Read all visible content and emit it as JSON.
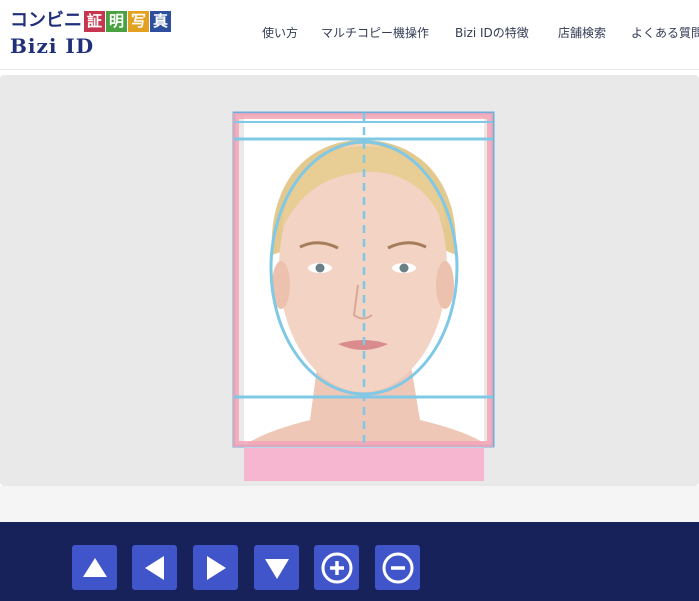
{
  "logo": {
    "kana": "コンビニ",
    "boxes": [
      {
        "char": "証",
        "color": "#c7364f"
      },
      {
        "char": "明",
        "color": "#4aa142"
      },
      {
        "char": "写",
        "color": "#e4a021"
      },
      {
        "char": "真",
        "color": "#2d4f9e"
      }
    ],
    "subtitle": "Bizi ID"
  },
  "nav": {
    "items": [
      "使い方",
      "マルチコピー機操作",
      "Bizi IDの特徴",
      "店舗検索",
      "よくある質問"
    ]
  },
  "photo": {
    "guide_color": "#7fc8e6",
    "frame_color": "#6eaedb",
    "pink_color": "#f5a4b6"
  },
  "toolbar": {
    "buttons": [
      {
        "name": "move-up-button",
        "icon": "arrow-up-icon"
      },
      {
        "name": "move-left-button",
        "icon": "arrow-left-icon"
      },
      {
        "name": "move-right-button",
        "icon": "arrow-right-icon"
      },
      {
        "name": "move-down-button",
        "icon": "arrow-down-icon"
      },
      {
        "name": "zoom-in-button",
        "icon": "zoom-in-icon"
      },
      {
        "name": "zoom-out-button",
        "icon": "zoom-out-icon"
      }
    ]
  }
}
